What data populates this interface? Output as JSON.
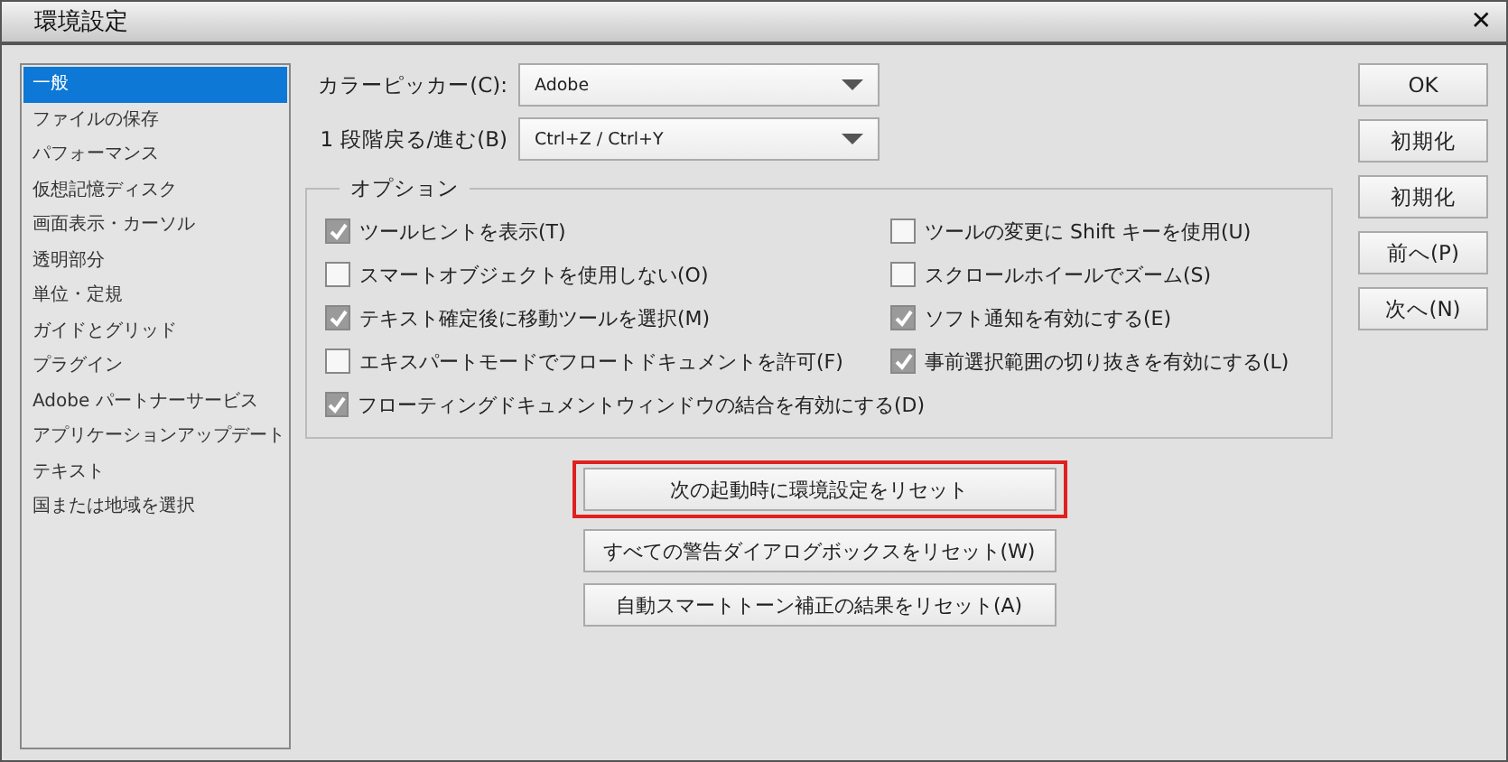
{
  "window": {
    "title": "環境設定",
    "close": "✕"
  },
  "sidebar": {
    "items": [
      {
        "label": "一般",
        "selected": true
      },
      {
        "label": "ファイルの保存",
        "selected": false
      },
      {
        "label": "パフォーマンス",
        "selected": false
      },
      {
        "label": "仮想記憶ディスク",
        "selected": false
      },
      {
        "label": "画面表示・カーソル",
        "selected": false
      },
      {
        "label": "透明部分",
        "selected": false
      },
      {
        "label": "単位・定規",
        "selected": false
      },
      {
        "label": "ガイドとグリッド",
        "selected": false
      },
      {
        "label": "プラグイン",
        "selected": false
      },
      {
        "label": "Adobe パートナーサービス",
        "selected": false
      },
      {
        "label": "アプリケーションアップデート",
        "selected": false
      },
      {
        "label": "テキスト",
        "selected": false
      },
      {
        "label": "国または地域を選択",
        "selected": false
      }
    ]
  },
  "dropdowns": [
    {
      "label": "カラーピッカー(C):",
      "value": "Adobe"
    },
    {
      "label": "1 段階戻る/進む(B)",
      "value": "Ctrl+Z / Ctrl+Y"
    }
  ],
  "options": {
    "title": "オプション",
    "left": [
      {
        "label": "ツールヒントを表示(T)",
        "checked": true
      },
      {
        "label": "スマートオブジェクトを使用しない(O)",
        "checked": false
      },
      {
        "label": "テキスト確定後に移動ツールを選択(M)",
        "checked": true
      },
      {
        "label": "エキスパートモードでフロートドキュメントを許可(F)",
        "checked": false
      },
      {
        "label": "フローティングドキュメントウィンドウの結合を有効にする(D)",
        "checked": true
      }
    ],
    "right": [
      {
        "label": "ツールの変更に Shift キーを使用(U)",
        "checked": false
      },
      {
        "label": "スクロールホイールでズーム(S)",
        "checked": false
      },
      {
        "label": "ソフト通知を有効にする(E)",
        "checked": true
      },
      {
        "label": "事前選択範囲の切り抜きを有効にする(L)",
        "checked": true
      }
    ]
  },
  "reset_buttons": [
    {
      "label": "次の起動時に環境設定をリセット",
      "highlighted": true
    },
    {
      "label": "すべての警告ダイアログボックスをリセット(W)",
      "highlighted": false
    },
    {
      "label": "自動スマートトーン補正の結果をリセット(A)",
      "highlighted": false
    }
  ],
  "side_buttons": [
    "OK",
    "初期化",
    "初期化",
    "前へ(P)",
    "次へ(N)"
  ]
}
